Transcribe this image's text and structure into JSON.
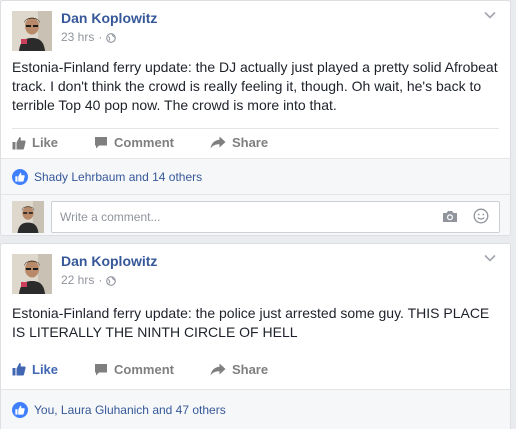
{
  "posts": [
    {
      "author": "Dan Koplowitz",
      "time": "23 hrs",
      "separator": "·",
      "text": "Estonia-Finland ferry update: the DJ actually just played a pretty solid Afrobeat track. I don't think the crowd is really feeling it, though. Oh wait, he's back to terrible Top 40 pop now. The crowd is more into that.",
      "actions": {
        "like": "Like",
        "comment": "Comment",
        "share": "Share"
      },
      "liked_by_viewer": false,
      "likes_summary": "Shady Lehrbaum and 14 others",
      "comment_placeholder": "Write a comment..."
    },
    {
      "author": "Dan Koplowitz",
      "time": "22 hrs",
      "separator": "·",
      "text": "Estonia-Finland ferry update: the police just arrested some guy. THIS PLACE IS LITERALLY THE NINTH CIRCLE OF HELL",
      "actions": {
        "like": "Like",
        "comment": "Comment",
        "share": "Share"
      },
      "liked_by_viewer": true,
      "likes_summary": "You, Laura Gluhanich and 47 others"
    }
  ],
  "icons": {
    "audience": "globe-icon",
    "menu": "chevron-down-icon",
    "like": "thumbs-up-icon",
    "comment": "comment-bubble-icon",
    "share": "share-arrow-icon",
    "likes_badge": "like-badge-icon",
    "photo": "camera-icon",
    "emoji": "smiley-icon"
  },
  "colors": {
    "link": "#365899",
    "liked": "#4267b2",
    "muted": "#90949c",
    "background": "#e9ebee"
  }
}
